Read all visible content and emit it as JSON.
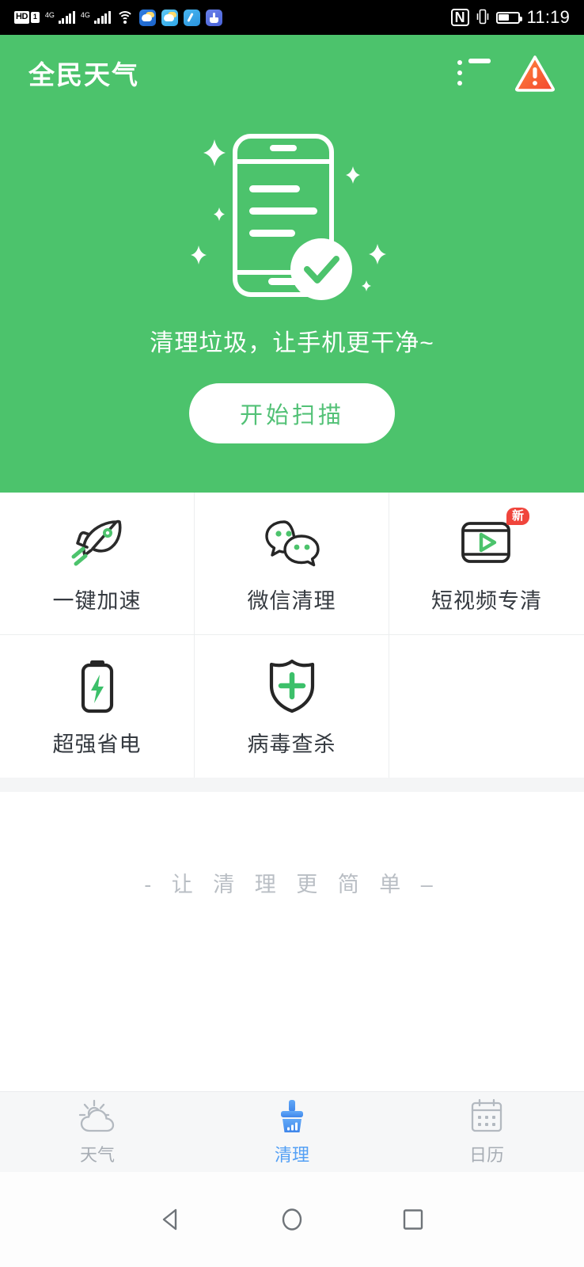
{
  "statusbar": {
    "hd_label": "HD",
    "sim_label": "1",
    "network_label_1": "4G",
    "network_label_2": "4G",
    "nfc_label": "N",
    "clock": "11:19",
    "icons": [
      "hd-icon",
      "sim-1-icon",
      "signal-4g-1-icon",
      "signal-4g-2-icon",
      "wifi-icon",
      "weather-app-icon",
      "weather-app-2-icon",
      "cleaner-app-icon",
      "broom-app-icon",
      "nfc-icon",
      "vibrate-icon",
      "battery-icon"
    ]
  },
  "appbar": {
    "title": "全民天气",
    "list_icon": "list-icon",
    "warning_icon": "warning-triangle-icon"
  },
  "hero": {
    "illustration": "phone-clean-illustration",
    "tagline": "清理垃圾，让手机更干净~",
    "scan_button": "开始扫描",
    "bg_color": "#4cc36c",
    "button_text_color": "#52c176"
  },
  "features": [
    {
      "label": "一键加速",
      "icon": "rocket-icon",
      "badge": null
    },
    {
      "label": "微信清理",
      "icon": "wechat-bubbles-icon",
      "badge": null
    },
    {
      "label": "短视频专清",
      "icon": "video-play-icon",
      "badge": "新"
    },
    {
      "label": "超强省电",
      "icon": "battery-bolt-icon",
      "badge": null
    },
    {
      "label": "病毒查杀",
      "icon": "shield-plus-icon",
      "badge": null
    }
  ],
  "slogan": "- 让 清 理 更 简 单 –",
  "tabs": [
    {
      "label": "天气",
      "icon": "weather-sun-cloud-icon",
      "active": false
    },
    {
      "label": "清理",
      "icon": "broom-icon",
      "active": true
    },
    {
      "label": "日历",
      "icon": "calendar-icon",
      "active": false
    }
  ],
  "colors": {
    "accent_green": "#4cc36c",
    "badge_red": "#f0453c",
    "tab_active_blue": "#54a0f5",
    "tab_inactive_gray": "#a7adb4",
    "slogan_gray": "#b9bec4"
  },
  "androidnav": {
    "back": "back-triangle-icon",
    "home": "home-circle-icon",
    "recents": "recents-square-icon"
  }
}
